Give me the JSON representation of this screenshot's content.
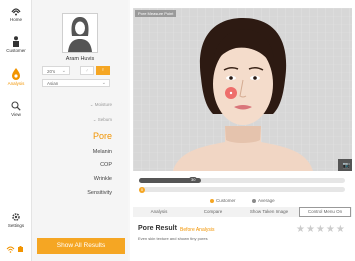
{
  "nav": {
    "items": [
      {
        "label": "Home",
        "icon": "home-icon"
      },
      {
        "label": "Customer",
        "icon": "customer-icon"
      },
      {
        "label": "Analysis",
        "icon": "analysis-icon"
      },
      {
        "label": "View",
        "icon": "search-icon"
      }
    ],
    "settings_label": "Settings",
    "active": "Analysis",
    "status_icons": [
      "wifi-icon",
      "battery-icon"
    ]
  },
  "profile": {
    "name": "Aram Huvis",
    "age": "20's",
    "gender_male": "♂",
    "gender_female": "♀",
    "race": "Asian",
    "zones": [
      "Moisture",
      "Sebum"
    ],
    "menu": [
      "Pore",
      "Melanin",
      "COP",
      "Wrinkle",
      "Sensitivity"
    ],
    "active_menu": "Pore",
    "show_all_label": "Show All Results"
  },
  "photo": {
    "label": "Pore Measure Point"
  },
  "sliders": {
    "customer_value": "30",
    "customer_fraction": 0.3,
    "average_value": "0",
    "average_fraction": 0.0
  },
  "legend": {
    "customer": "Customer",
    "average": "Average"
  },
  "tabs": [
    "Analysis",
    "Compare",
    "Show Taken Image",
    "Control Menu On"
  ],
  "result": {
    "title": "Pore Result",
    "subtitle": "Before Analysis",
    "description": "Even skin texture and shown tiny pores",
    "stars": "★★★★★"
  },
  "colors": {
    "accent": "#f5a623",
    "accent_text": "#f29400",
    "dark": "#555555"
  }
}
